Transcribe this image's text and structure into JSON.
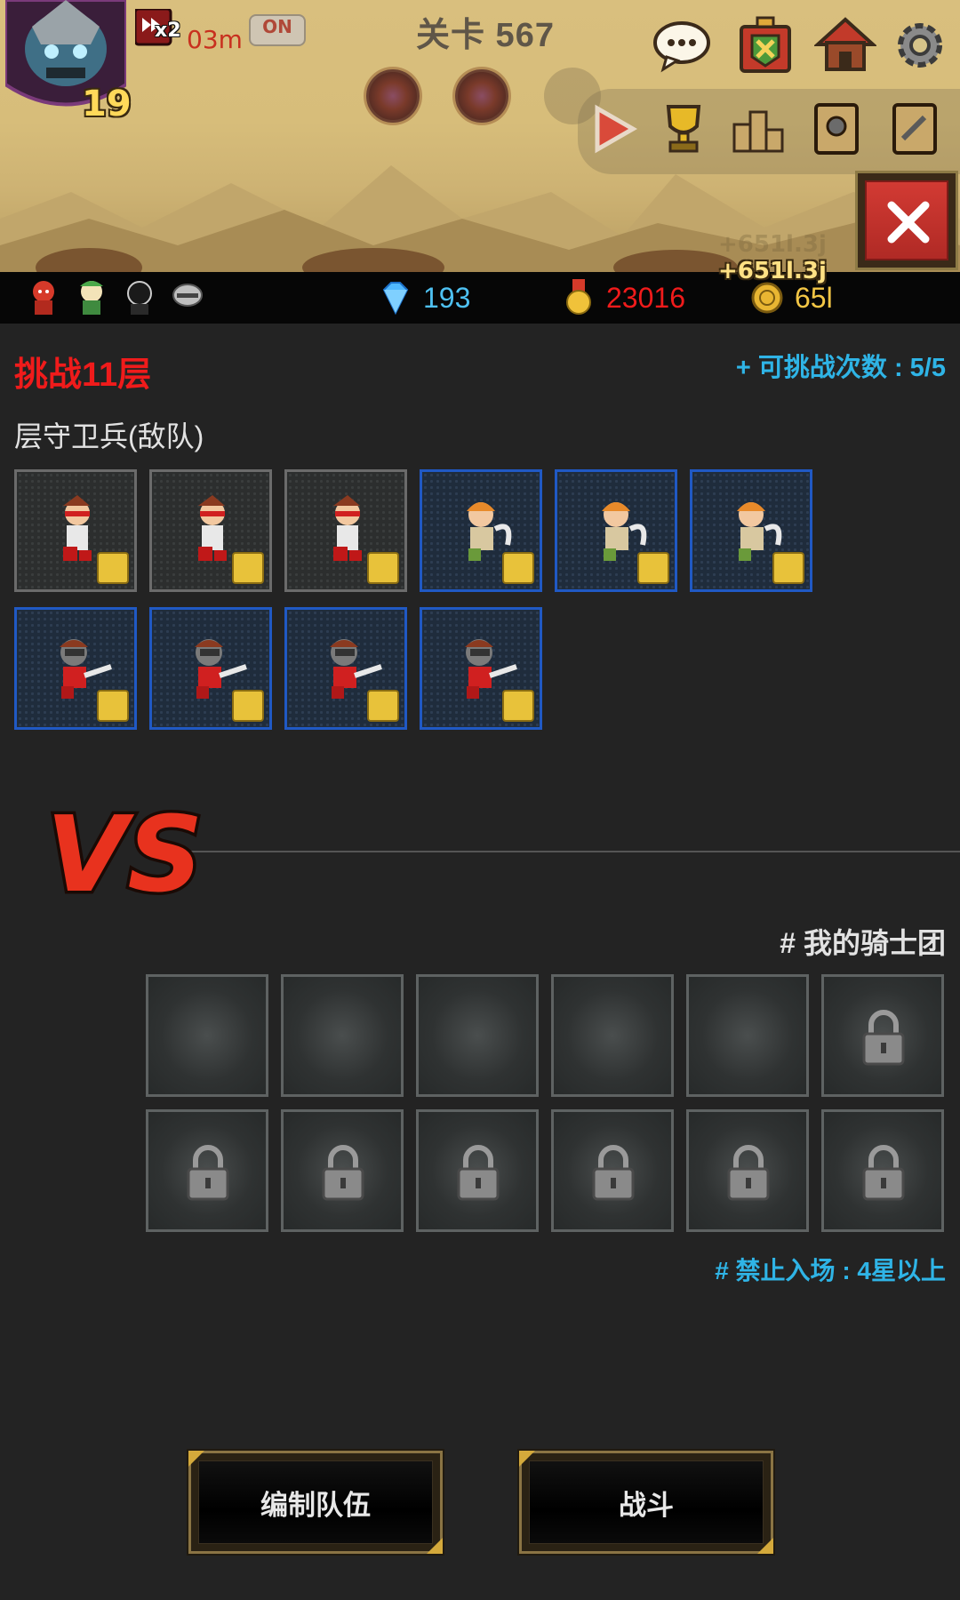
{
  "scene": {
    "hero_level": "19",
    "speed": "x2",
    "timer": "03m",
    "auto_toggle": "ON",
    "stage_title": "关卡 567",
    "floating_gain": "+651l.3j"
  },
  "resources": {
    "gems": "193",
    "medals": "23016",
    "gold": "65l"
  },
  "challenge": {
    "title": "挑战11层",
    "attempts": "+ 可挑战次数 : 5/5",
    "enemy_heading": "层守卫兵(敌队)"
  },
  "my_team": {
    "heading": "# 我的骑士团",
    "restriction": "# 禁止入场 : 4星以上"
  },
  "buttons": {
    "edit_team": "编制队伍",
    "battle": "战斗"
  },
  "colors": {
    "challenge_red": "#f01b1b",
    "info_blue": "#2fb4e6",
    "enemy_rare_border": "#2059c4",
    "enemy_common_border": "#6b6b6b"
  },
  "icons": {
    "top": [
      "chat-icon",
      "guild-banner-icon",
      "home-icon",
      "settings-icon"
    ],
    "bar": [
      "play-icon",
      "trophy-icon",
      "ranking-podium-icon",
      "hero-book-icon",
      "skill-book-icon"
    ]
  }
}
